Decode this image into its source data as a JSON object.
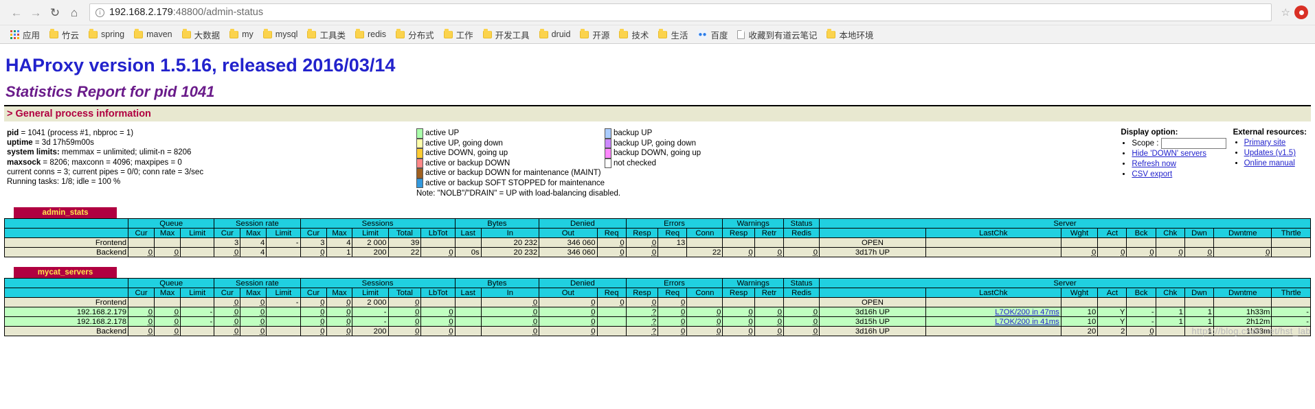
{
  "browser": {
    "nav": {
      "back_icon": "arrow-left-icon",
      "forward_icon": "arrow-right-icon",
      "reload_icon": "reload-icon",
      "home_icon": "home-icon",
      "info_glyph": "i",
      "star_glyph": "☆"
    },
    "url_host": "192.168.2.179",
    "url_rest": ":48800/admin-status",
    "bookmarks": [
      {
        "label": "应用",
        "icon": "apps-grid-icon"
      },
      {
        "label": "竹云",
        "icon": "folder-icon"
      },
      {
        "label": "spring",
        "icon": "folder-icon"
      },
      {
        "label": "maven",
        "icon": "folder-icon"
      },
      {
        "label": "大数据",
        "icon": "folder-icon"
      },
      {
        "label": "my",
        "icon": "folder-icon"
      },
      {
        "label": "mysql",
        "icon": "folder-icon"
      },
      {
        "label": "工具类",
        "icon": "folder-icon"
      },
      {
        "label": "redis",
        "icon": "folder-icon"
      },
      {
        "label": "分布式",
        "icon": "folder-icon"
      },
      {
        "label": "工作",
        "icon": "folder-icon"
      },
      {
        "label": "开发工具",
        "icon": "folder-icon"
      },
      {
        "label": "druid",
        "icon": "folder-icon"
      },
      {
        "label": "开源",
        "icon": "folder-icon"
      },
      {
        "label": "技术",
        "icon": "folder-icon"
      },
      {
        "label": "生活",
        "icon": "folder-icon"
      },
      {
        "label": "百度",
        "icon": "baidu-icon"
      },
      {
        "label": "收藏到有道云笔记",
        "icon": "page-icon"
      },
      {
        "label": "本地环境",
        "icon": "folder-icon"
      }
    ]
  },
  "page": {
    "title": "HAProxy version 1.5.16, released 2016/03/14",
    "subtitle": "Statistics Report for pid 1041",
    "section_title": "> General process information",
    "process_info": [
      {
        "key": "pid",
        "rest": " = 1041 (process #1, nbproc = 1)"
      },
      {
        "key": "uptime",
        "rest": " = 3d 17h59m00s"
      },
      {
        "key": "system limits:",
        "rest": " memmax = unlimited; ulimit-n = 8206"
      },
      {
        "key": "maxsock",
        "rest": " = 8206; maxconn = 4096; maxpipes = 0"
      },
      {
        "key": "",
        "rest": "current conns = 3; current pipes = 0/0; conn rate = 3/sec"
      },
      {
        "key": "",
        "rest": "Running tasks: 1/8; idle = 100 %"
      }
    ],
    "legend_left": [
      {
        "label": "active UP",
        "color": "#aaffaa"
      },
      {
        "label": "active UP, going down",
        "color": "#ffffaa"
      },
      {
        "label": "active DOWN, going up",
        "color": "#ffcc33"
      },
      {
        "label": "active or backup DOWN",
        "color": "#ff8888"
      },
      {
        "label": "active or backup DOWN for maintenance (MAINT)",
        "color": "#a06020"
      },
      {
        "label": "active or backup SOFT STOPPED for maintenance",
        "color": "#3399dd"
      }
    ],
    "legend_right": [
      {
        "label": "backup UP",
        "color": "#aaccff"
      },
      {
        "label": "backup UP, going down",
        "color": "#cc88ff"
      },
      {
        "label": "backup DOWN, going up",
        "color": "#ff88ff"
      },
      {
        "label": "not checked",
        "color": "#ffffff"
      }
    ],
    "legend_note": "Note: \"NOLB\"/\"DRAIN\" = UP with load-balancing disabled.",
    "display_option": {
      "header": "Display option:",
      "scope_label": "Scope :",
      "scope_value": "",
      "links": [
        "Hide 'DOWN' servers",
        "Refresh now",
        "CSV export"
      ]
    },
    "external_resources": {
      "header": "External resources:",
      "links": [
        "Primary site",
        "Updates (v1.5)",
        "Online manual"
      ]
    }
  },
  "tables": [
    {
      "proxy_name": "admin_stats",
      "groups": [
        {
          "label": "",
          "span": 1
        },
        {
          "label": "Queue",
          "span": 3
        },
        {
          "label": "Session rate",
          "span": 3
        },
        {
          "label": "Sessions",
          "span": 5
        },
        {
          "label": "Bytes",
          "span": 2
        },
        {
          "label": "Denied",
          "span": 2
        },
        {
          "label": "Errors",
          "span": 3
        },
        {
          "label": "Warnings",
          "span": 2
        },
        {
          "label": "Status",
          "span": 1
        },
        {
          "label": "Server",
          "span": 9
        }
      ],
      "columns": [
        "",
        "Cur",
        "Max",
        "Limit",
        "Cur",
        "Max",
        "Limit",
        "Cur",
        "Max",
        "Limit",
        "Total",
        "LbTot",
        "Last",
        "In",
        "Out",
        "Req",
        "Resp",
        "Req",
        "Conn",
        "Resp",
        "Retr",
        "Redis",
        "",
        "LastChk",
        "Wght",
        "Act",
        "Bck",
        "Chk",
        "Dwn",
        "Dwntme",
        "Thrtle"
      ],
      "rows": [
        {
          "type": "frontend",
          "name": "Frontend",
          "cells": [
            "",
            "",
            "",
            "3",
            "4",
            "-",
            "3",
            "4",
            "2 000",
            "39",
            "",
            "",
            "20 232",
            "346 060",
            "0",
            "0",
            "13",
            "",
            "",
            "",
            "",
            "OPEN",
            "",
            "",
            "",
            "",
            "",
            "",
            "",
            ""
          ]
        },
        {
          "type": "backend",
          "name": "Backend",
          "cells": [
            "0",
            "0",
            "",
            "0",
            "4",
            "",
            "0",
            "1",
            "200",
            "22",
            "0",
            "0s",
            "20 232",
            "346 060",
            "0",
            "0",
            "",
            "22",
            "0",
            "0",
            "0",
            "3d17h UP",
            "",
            "0",
            "0",
            "0",
            "0",
            "0",
            "0",
            ""
          ]
        }
      ]
    },
    {
      "proxy_name": "mycat_servers",
      "groups": [
        {
          "label": "",
          "span": 1
        },
        {
          "label": "Queue",
          "span": 3
        },
        {
          "label": "Session rate",
          "span": 3
        },
        {
          "label": "Sessions",
          "span": 5
        },
        {
          "label": "Bytes",
          "span": 2
        },
        {
          "label": "Denied",
          "span": 2
        },
        {
          "label": "Errors",
          "span": 3
        },
        {
          "label": "Warnings",
          "span": 2
        },
        {
          "label": "Status",
          "span": 1
        },
        {
          "label": "Server",
          "span": 9
        }
      ],
      "columns": [
        "",
        "Cur",
        "Max",
        "Limit",
        "Cur",
        "Max",
        "Limit",
        "Cur",
        "Max",
        "Limit",
        "Total",
        "LbTot",
        "Last",
        "In",
        "Out",
        "Req",
        "Resp",
        "Req",
        "Conn",
        "Resp",
        "Retr",
        "Redis",
        "",
        "LastChk",
        "Wght",
        "Act",
        "Bck",
        "Chk",
        "Dwn",
        "Dwntme",
        "Thrtle"
      ],
      "rows": [
        {
          "type": "frontend",
          "name": "Frontend",
          "cells": [
            "",
            "",
            "",
            "0",
            "0",
            "-",
            "0",
            "0",
            "2 000",
            "0",
            "",
            "",
            "0",
            "0",
            "0",
            "0",
            "0",
            "",
            "",
            "",
            "",
            "OPEN",
            "",
            "",
            "",
            "",
            "",
            "",
            "",
            ""
          ]
        },
        {
          "type": "srv",
          "name": "192.168.2.179",
          "cells": [
            "0",
            "0",
            "-",
            "0",
            "0",
            "",
            "0",
            "0",
            "-",
            "0",
            "0",
            "",
            "0",
            "0",
            "",
            "?",
            "0",
            "0",
            "0",
            "0",
            "0",
            "3d16h UP",
            "L7OK/200 in 47ms",
            "10",
            "Y",
            "-",
            "1",
            "1",
            "1h33m",
            "-"
          ]
        },
        {
          "type": "srv",
          "name": "192.168.2.178",
          "cells": [
            "0",
            "0",
            "-",
            "0",
            "0",
            "",
            "0",
            "0",
            "-",
            "0",
            "0",
            "",
            "0",
            "0",
            "",
            "?",
            "0",
            "0",
            "0",
            "0",
            "0",
            "3d15h UP",
            "L7OK/200 in 41ms",
            "10",
            "Y",
            "-",
            "1",
            "1",
            "2h12m",
            "-"
          ]
        },
        {
          "type": "backend",
          "name": "Backend",
          "cells": [
            "0",
            "0",
            "",
            "0",
            "0",
            "",
            "0",
            "0",
            "200",
            "0",
            "0",
            "",
            "0",
            "0",
            "",
            "?",
            "0",
            "0",
            "0",
            "0",
            "0",
            "3d16h UP",
            "",
            "20",
            "2",
            "0",
            "",
            "1",
            "1h33m",
            ""
          ]
        }
      ]
    }
  ],
  "watermark": "https://blog.csdn.net/hst_lab"
}
